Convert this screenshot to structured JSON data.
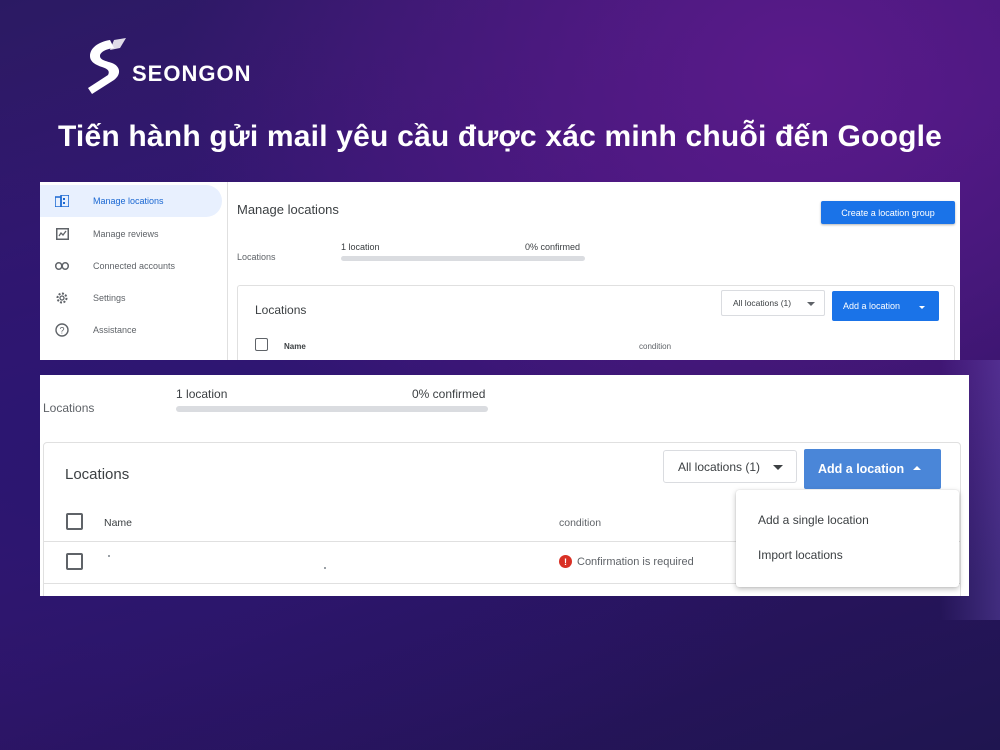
{
  "brand": {
    "name": "SEONGON"
  },
  "headline": "Tiến hành gửi mail yêu cầu được xác minh chuỗi đến Google",
  "panel1": {
    "sidebar": {
      "items": [
        {
          "label": "Manage locations",
          "icon": "building-icon",
          "active": true
        },
        {
          "label": "Manage reviews",
          "icon": "reviews-icon",
          "active": false
        },
        {
          "label": "Connected accounts",
          "icon": "link-icon",
          "active": false
        },
        {
          "label": "Settings",
          "icon": "gear-icon",
          "active": false
        },
        {
          "label": "Assistance",
          "icon": "help-icon",
          "active": false
        }
      ]
    },
    "title": "Manage locations",
    "create_button": "Create a location group",
    "locations_label": "Locations",
    "location_count": "1 location",
    "confirmed": "0% confirmed",
    "confirmed_progress": 0,
    "card": {
      "title": "Locations",
      "filter": "All locations (1)",
      "add_button": "Add a location",
      "columns": {
        "name": "Name",
        "condition": "condition"
      }
    }
  },
  "panel2": {
    "locations_label": "Locations",
    "location_count_num": "1",
    "location_count_unit": " location",
    "confirmed_num": "0%",
    "confirmed_unit": " confirmed",
    "confirmed_progress": 0,
    "card": {
      "title": "Locations",
      "filter": "All locations (1)",
      "add_button": "Add a location",
      "columns": {
        "name": "Name",
        "condition": "condition"
      },
      "rows": [
        {
          "status": "Confirmation is required"
        }
      ]
    },
    "dropdown": {
      "items": [
        "Add a single location",
        "Import locations"
      ]
    }
  },
  "colors": {
    "primary_blue": "#1a73e8",
    "add_button_blue": "#4a86d8",
    "error_red": "#d93025"
  }
}
